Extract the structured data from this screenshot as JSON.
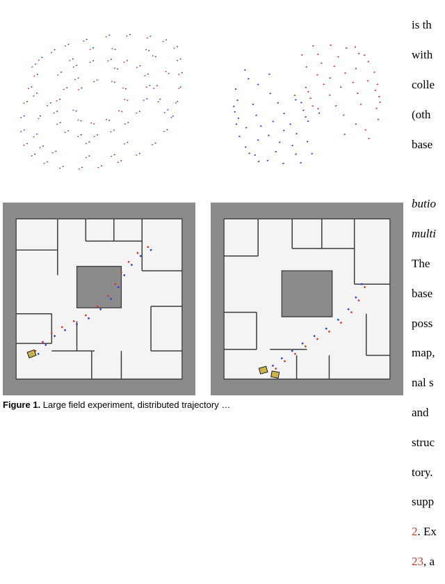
{
  "caption": {
    "label": "Figure 1.",
    "text_part": " Large field experiment, distributed trajectory …"
  },
  "right_text": {
    "l1": "is th",
    "l2": "with",
    "l3": "colle",
    "l4": "(oth",
    "l5": "base",
    "blank1": " ",
    "l6_i": "butio",
    "l7_i": "multi",
    "l8": "The ",
    "l9": "base",
    "l10": "poss",
    "l11": "map,",
    "l12": "nal s",
    "l13": "and ",
    "l14": "struc",
    "l15": "tory.",
    "l16": "supp",
    "l17_a": "2",
    "l17_b": ". Ex",
    "l18_a": "23",
    "l18_b": ", a"
  }
}
